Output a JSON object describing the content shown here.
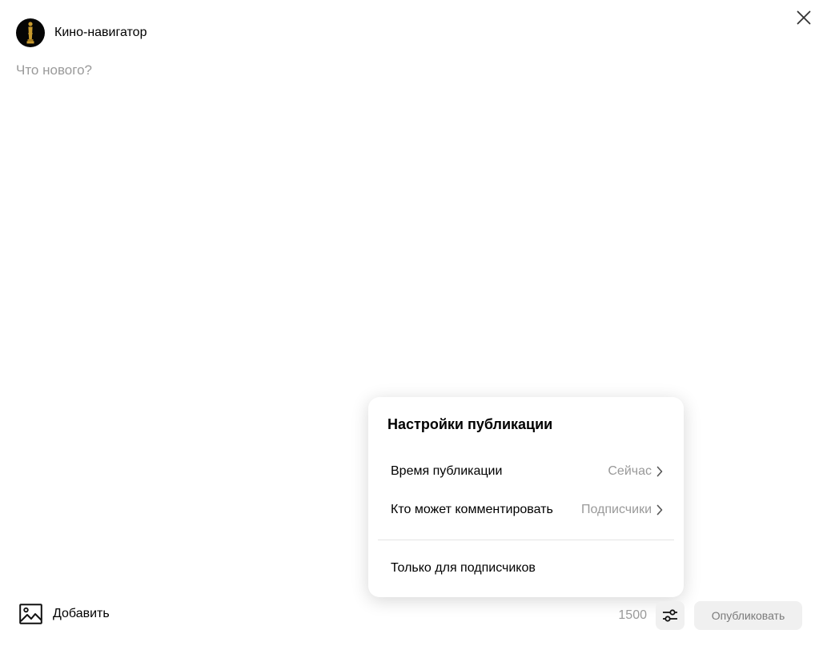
{
  "header": {
    "channel_name": "Кино-навигатор",
    "avatar_icon": "oscar-statuette-icon"
  },
  "composer": {
    "placeholder": "Что нового?",
    "value": ""
  },
  "publication_settings": {
    "title": "Настройки публикации",
    "rows": [
      {
        "label": "Время публикации",
        "value": "Сейчас"
      },
      {
        "label": "Кто может комментировать",
        "value": "Подписчики"
      }
    ],
    "subscribers_only_label": "Только для подписчиков"
  },
  "footer": {
    "add_label": "Добавить",
    "char_limit": "1500",
    "publish_label": "Опубликовать"
  },
  "colors": {
    "muted_text": "#9a9a9a",
    "button_bg": "#f0f0f0",
    "avatar_bg": "#050505",
    "statuette_gold": "#c89a2e"
  }
}
